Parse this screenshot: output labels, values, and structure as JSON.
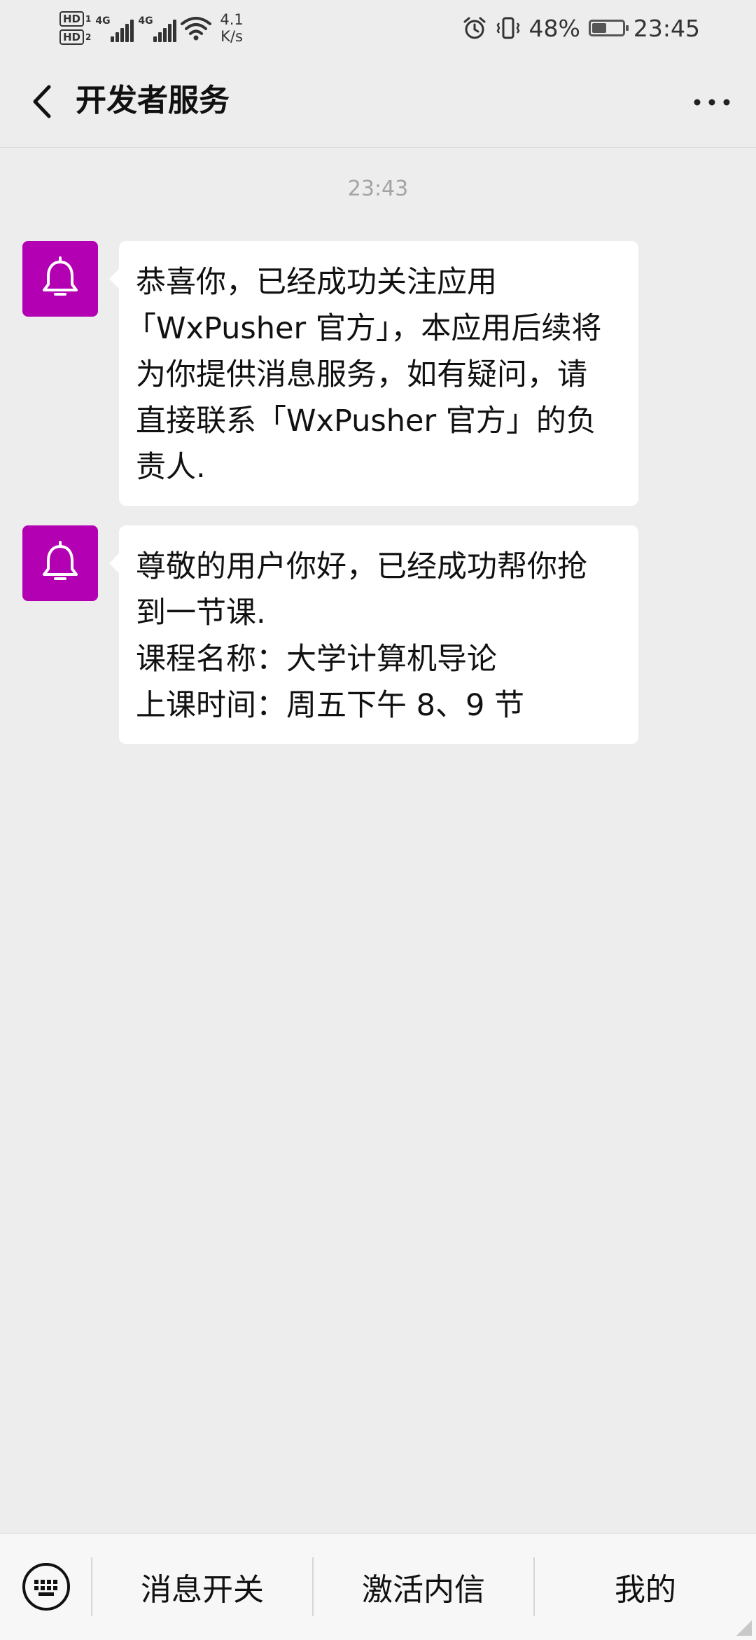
{
  "status_bar": {
    "hd1": "HD",
    "hd1_sub": "1",
    "hd2": "HD",
    "hd2_sub": "2",
    "net1": "4G",
    "net2": "4G",
    "speed_value": "4.1",
    "speed_unit": "K/s",
    "battery_percent": "48%",
    "battery_level": 0.48,
    "time": "23:45"
  },
  "header": {
    "title": "开发者服务",
    "back_icon": "chevron-left-icon",
    "more_icon": "more-dots-icon"
  },
  "chat": {
    "timestamp": "23:43",
    "messages": [
      {
        "avatar_icon": "bell-icon",
        "lines": [
          "恭喜你，已经成功关注应用",
          "「WxPusher 官方」，本应用后续将",
          "为你提供消息服务，如有疑问，请",
          "直接联系「WxPusher 官方」的负",
          "责人."
        ]
      },
      {
        "avatar_icon": "bell-icon",
        "lines": [
          "尊敬的用户你好，已经成功帮你抢",
          "到一节课.",
          "课程名称：大学计算机导论",
          "上课时间：周五下午 8、9 节"
        ]
      }
    ]
  },
  "bottom_bar": {
    "keyboard_icon": "keyboard-icon",
    "items": [
      {
        "label": "消息开关"
      },
      {
        "label": "激活内信"
      },
      {
        "label": "我的"
      }
    ]
  },
  "colors": {
    "background": "#ededed",
    "avatar": "#b200b2",
    "bubble": "#ffffff",
    "timestamp": "#a3a3a3"
  }
}
